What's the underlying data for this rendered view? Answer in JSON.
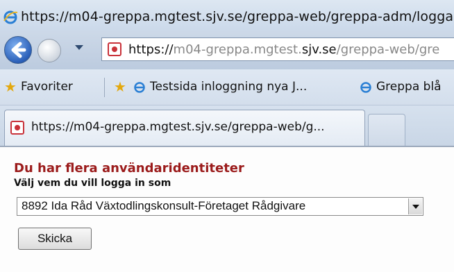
{
  "window": {
    "title": "https://m04-greppa.mgtest.sjv.se/greppa-web/greppa-adm/logga"
  },
  "navigation": {
    "address": {
      "scheme": "https://",
      "host_prefix": "m04-greppa.mgtest.",
      "host_domain": "sjv.se",
      "path": "/greppa-web/gre"
    }
  },
  "favorites_bar": {
    "favorites_label": "Favoriter",
    "items": [
      {
        "label": "Testsida inloggning nya J..."
      },
      {
        "label": "Greppa blå"
      }
    ]
  },
  "tabs": [
    {
      "title": "https://m04-greppa.mgtest.sjv.se/greppa-web/g..."
    }
  ],
  "page": {
    "heading": "Du har flera användaridentiteter",
    "instruction": "Välj vem du vill logga in som",
    "identity_select": {
      "selected": "8892 Ida Råd Växtodlingskonsult-Företaget Rådgivare"
    },
    "submit_label": "Skicka"
  },
  "colors": {
    "heading": "#9b1b1b",
    "chrome": "#cbd9ea"
  }
}
